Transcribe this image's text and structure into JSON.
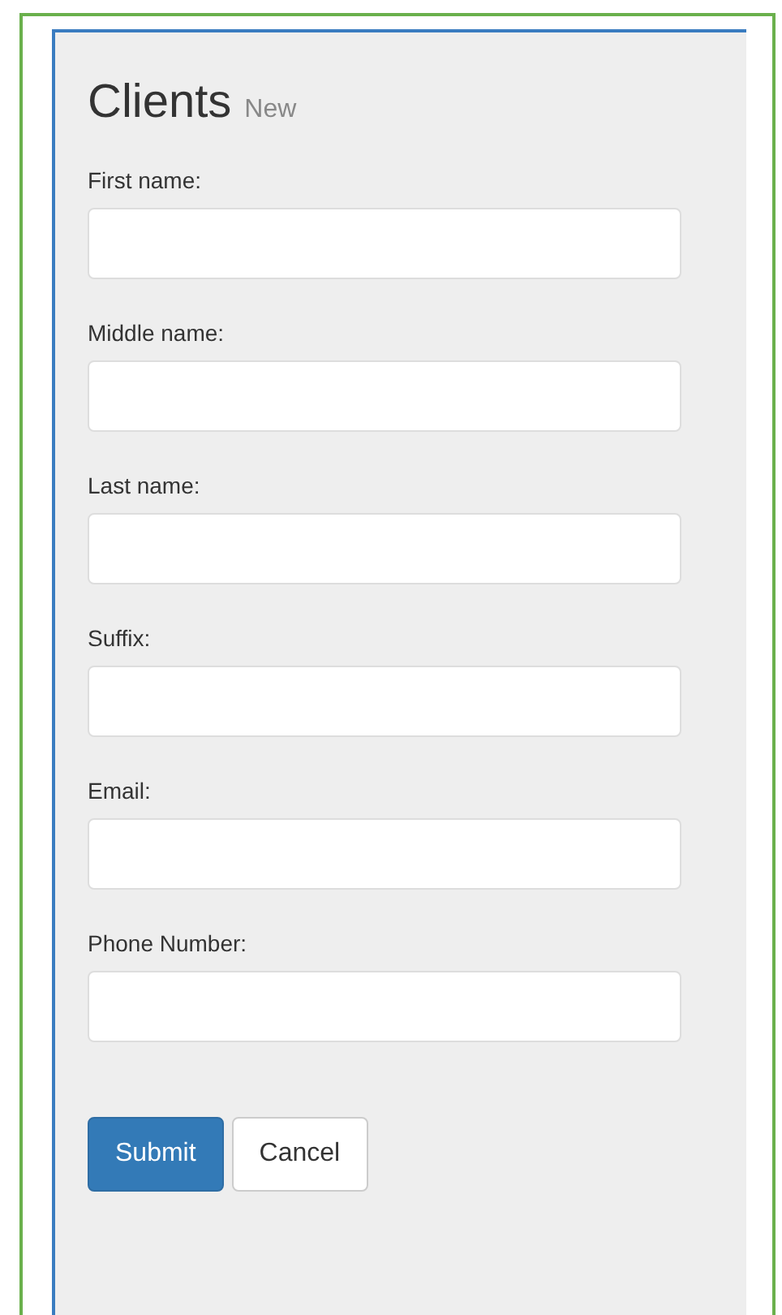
{
  "header": {
    "title": "Clients",
    "subtitle": "New"
  },
  "fields": [
    {
      "label": "First name:"
    },
    {
      "label": "Middle name:"
    },
    {
      "label": "Last name:"
    },
    {
      "label": "Suffix:"
    },
    {
      "label": "Email:"
    },
    {
      "label": "Phone Number:"
    }
  ],
  "buttons": [
    {
      "label": "Submit",
      "kind": "primary"
    },
    {
      "label": "Cancel",
      "kind": "default"
    }
  ]
}
